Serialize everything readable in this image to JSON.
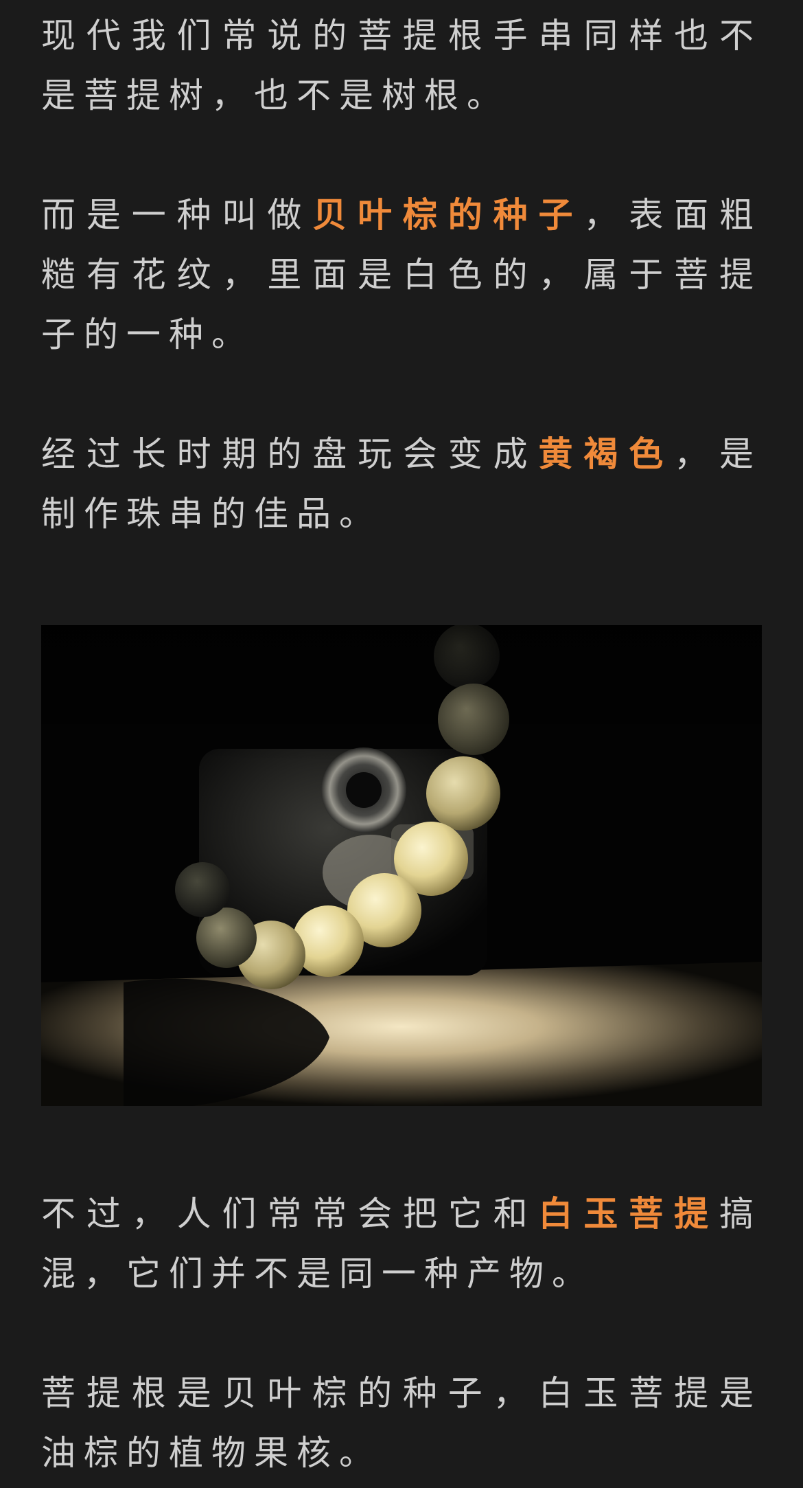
{
  "paragraphs": {
    "p1": {
      "text": "现代我们常说的菩提根手串同样也不是菩提树，也不是树根。"
    },
    "p2": {
      "before": "而是一种叫做",
      "highlight": "贝叶棕的种子",
      "after": "，表面粗糙有花纹，里面是白色的，属于菩提子的一种。"
    },
    "p3": {
      "before": "经过长时期的盘玩会变成",
      "highlight": "黄褐色",
      "after": "，是制作珠串的佳品。"
    },
    "p4": {
      "before": "不过，人们常常会把它和",
      "highlight": "白玉菩提",
      "after": "搞混，它们并不是同一种产物。"
    },
    "p5": {
      "text": "菩提根是贝叶棕的种子，白玉菩提是油棕的植物果核。"
    }
  },
  "colors": {
    "background": "#1b1b1b",
    "body_text": "#cfcfcf",
    "highlight": "#f08a3a"
  }
}
